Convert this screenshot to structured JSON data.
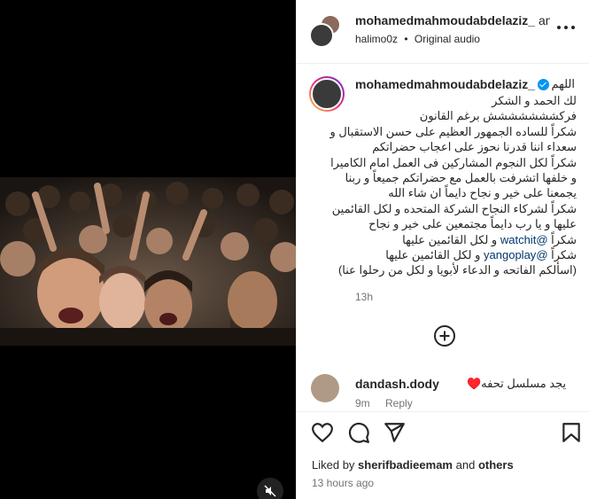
{
  "header": {
    "username": "mohamedmahmoudabdelaziz_",
    "and_text": "and",
    "sub_user": "halimo0z",
    "sub_separator": "•",
    "audio": "Original audio"
  },
  "caption": {
    "username": "mohamedmahmoudabdelaziz_",
    "first_text": "اللهم",
    "lines": [
      "لك الحمد و الشكر",
      "فركششششششش برغم القانون",
      "شكراً للساده الجمهور العظيم على حسن الاستقبال و",
      "سعداء اننا قدرنا نحوز على اعجاب حضراتكم",
      "شكراً لكل النجوم المشاركين فى العمل امام الكاميرا",
      "و خلفها اتشرفت بالعمل مع حضراتكم جميعاً و ربنا",
      "يجمعنا على خير و نجاح دايماً ان شاء الله",
      "شكراً لشركاء النجاح الشركة المتحده و لكل القائمين",
      "عليها و يا رب دايماً مجتمعين على خير و نجاح",
      "(اسألكم الفاتحه و الدعاء لأبويا و لكل من رحلوا عنا)"
    ],
    "mention_line_1": {
      "prefix": "شكراً",
      "mention": "@watchit",
      "suffix": "و لكل القائمين عليها"
    },
    "mention_line_2": {
      "prefix": "شكراً",
      "mention": "@yangoplay",
      "suffix": "و لكل القائمين عليها"
    },
    "time": "13h"
  },
  "comment": {
    "username": "dandash.dody",
    "text": "يجد مسلسل تحفه♥️",
    "time": "9m",
    "reply": "Reply"
  },
  "footer": {
    "liked_prefix": "Liked by",
    "liked_user": "sherifbadieemam",
    "liked_suffix": "and",
    "liked_others": "others",
    "posted": "13 hours ago"
  },
  "colors": {
    "link": "#00376b",
    "verified": "#0095f6",
    "muted": "#737373"
  },
  "icons": [
    "more-icon",
    "verified-icon",
    "add-comment-icon",
    "heart-icon",
    "comment-icon",
    "share-icon",
    "bookmark-icon",
    "mute-icon"
  ]
}
